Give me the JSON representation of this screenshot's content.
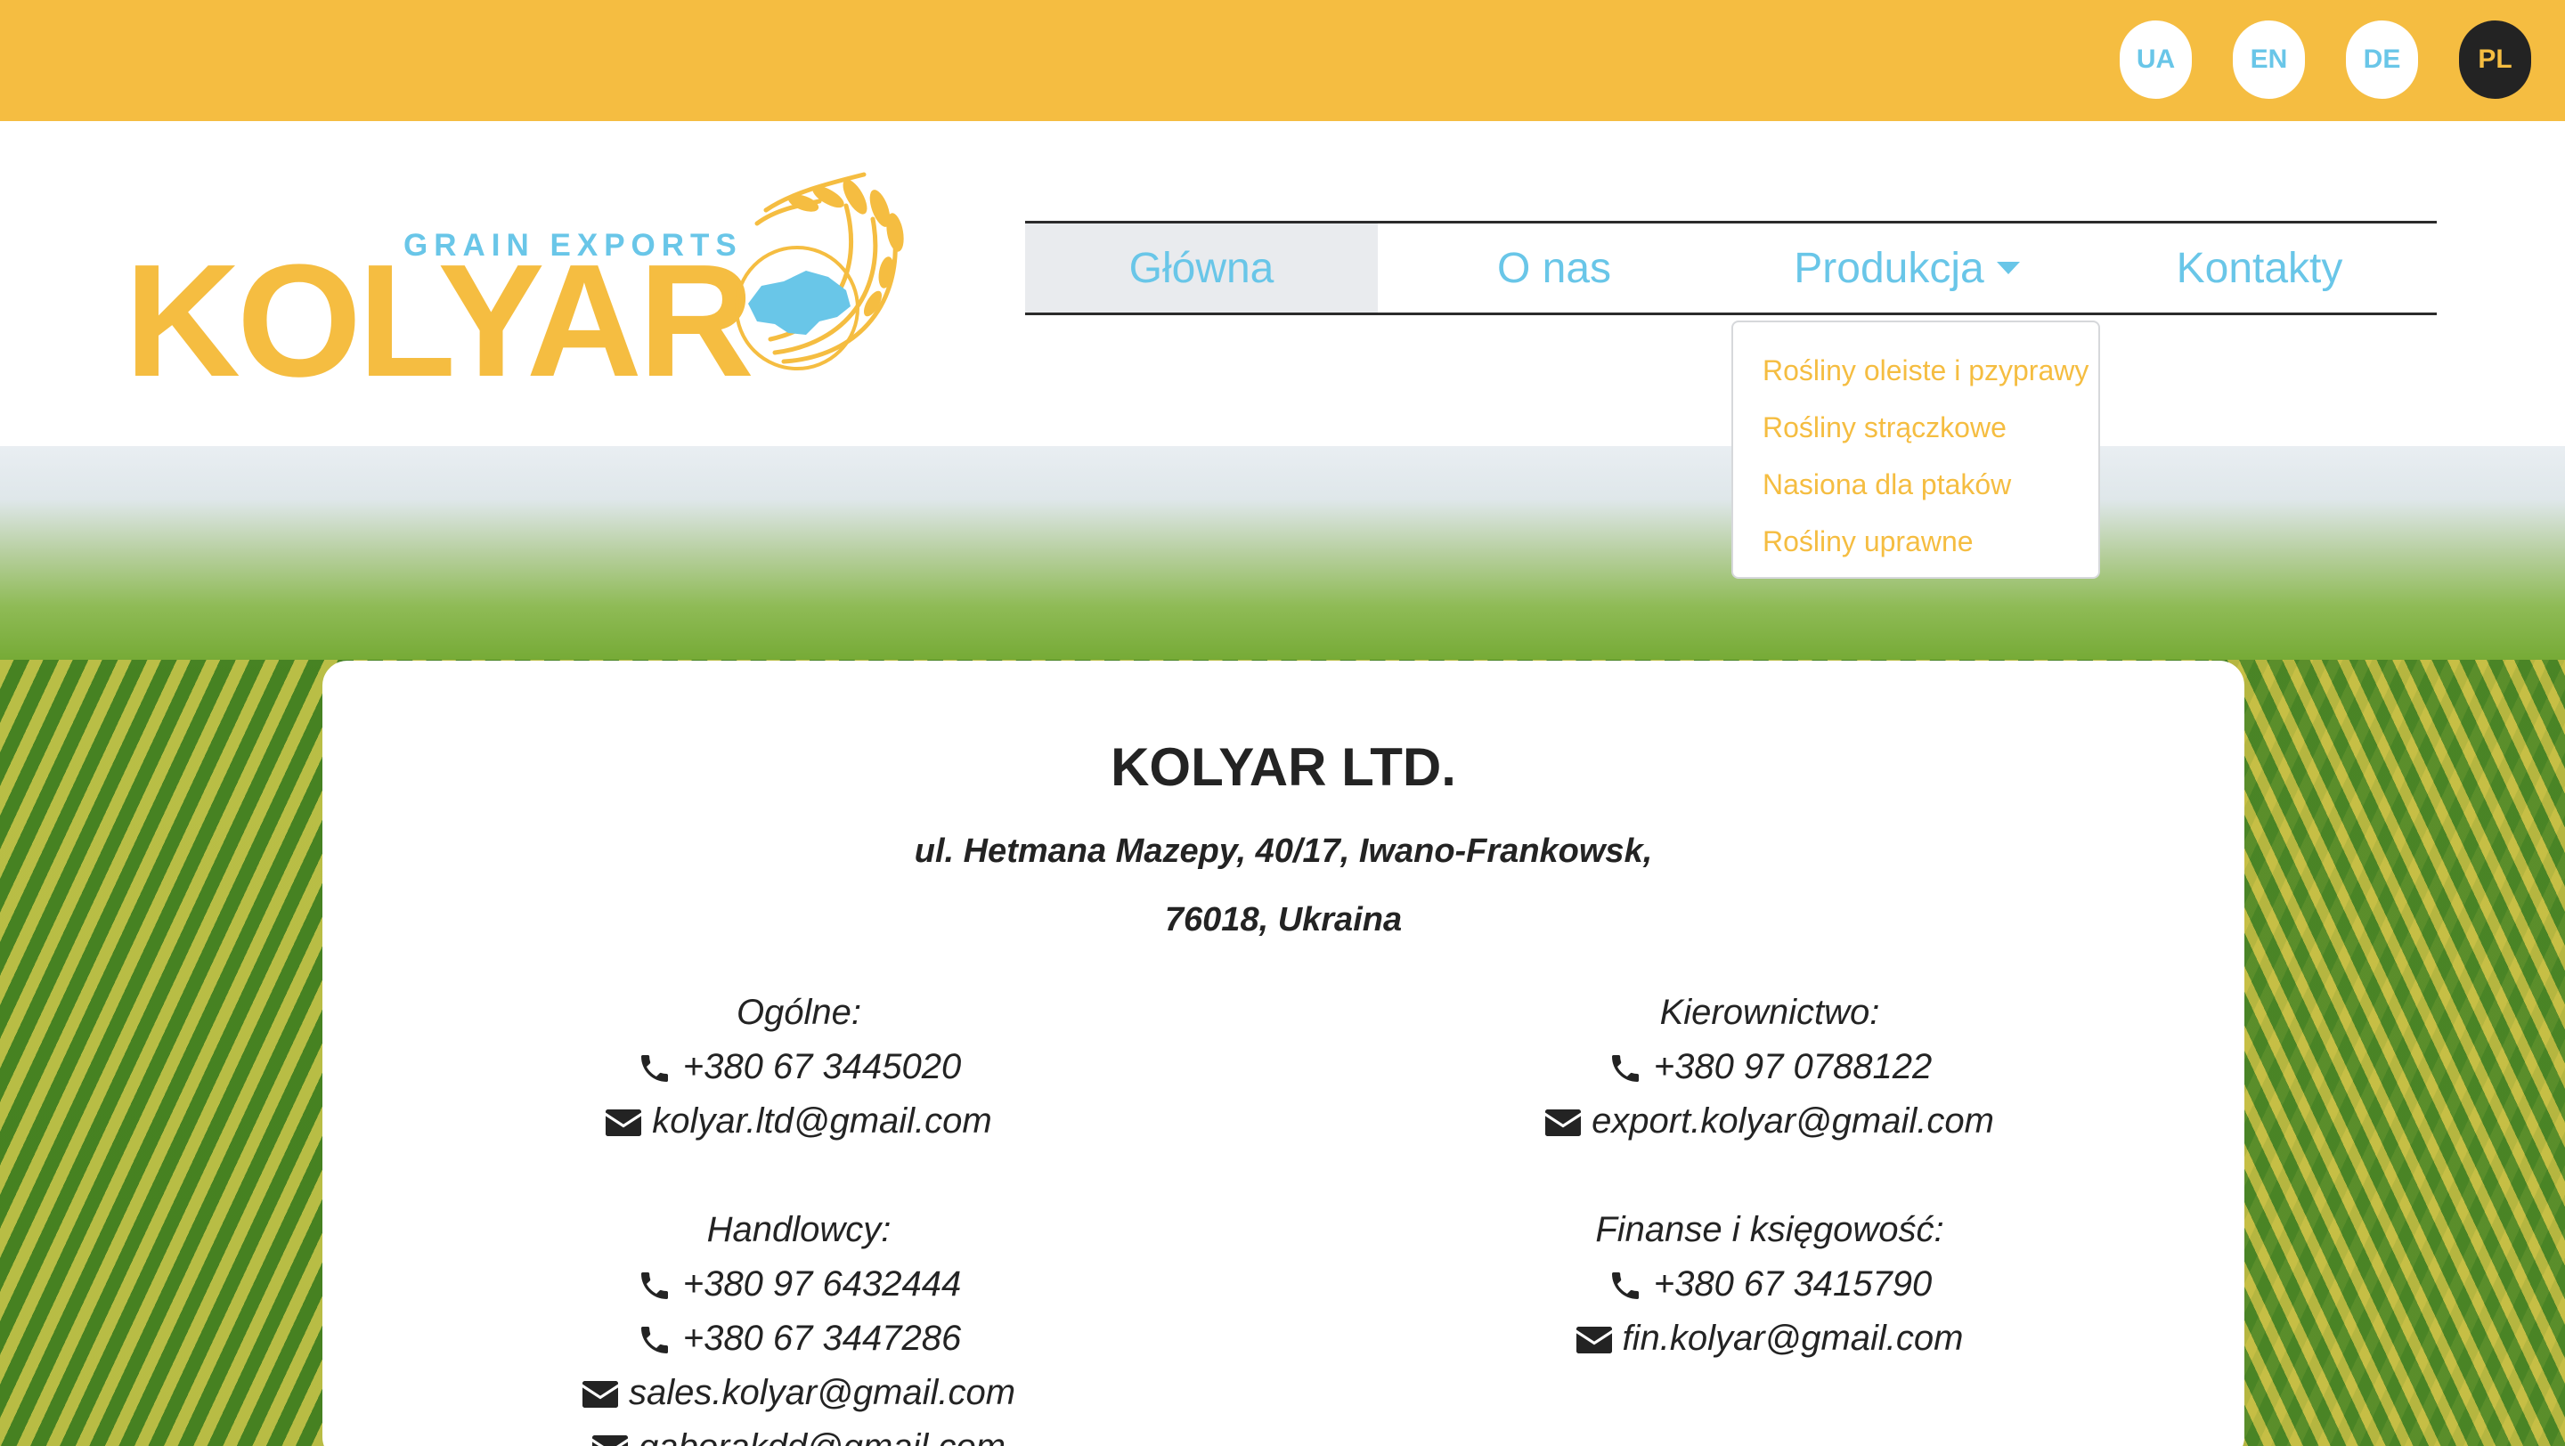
{
  "languages": [
    {
      "code": "UA",
      "active": false
    },
    {
      "code": "EN",
      "active": false
    },
    {
      "code": "DE",
      "active": false
    },
    {
      "code": "PL",
      "active": true
    }
  ],
  "logo": {
    "tagline": "GRAIN EXPORTS",
    "name": "KOLYAR"
  },
  "nav": {
    "items": [
      "Główna",
      "O nas",
      "Produkcja",
      "Kontakty"
    ],
    "active": "Główna",
    "dropdown": [
      "Rośliny oleiste i pzyprawy",
      "Rośliny strączkowe",
      "Nasiona dla ptaków",
      "Rośliny uprawne"
    ]
  },
  "contact": {
    "company": "KOLYAR LTD.",
    "address_line1": "ul. Hetmana Mazepy, 40/17, Iwano-Frankowsk,",
    "address_line2": "76018, Ukraina",
    "left": {
      "general_title": "Ogólne:",
      "general_phone": "+380 67 3445020",
      "general_email": "kolyar.ltd@gmail.com",
      "sales_title": "Handlowcy:",
      "sales_phone1": "+380 97 6432444",
      "sales_phone2": "+380 67 3447286",
      "sales_email1": "sales.kolyar@gmail.com",
      "sales_email2": "gaborakdd@gmail.com"
    },
    "right": {
      "management_title": "Kierownictwo:",
      "management_phone": "+380 97 0788122",
      "management_email": "export.kolyar@gmail.com",
      "finance_title": "Finanse i księgowość:",
      "finance_phone": "+380 67 3415790",
      "finance_email": "fin.kolyar@gmail.com"
    }
  },
  "icons": {
    "phone": "phone-icon",
    "email": "envelope-icon"
  },
  "colors": {
    "brand_yellow": "#f5bd41",
    "brand_blue": "#69c6e8",
    "dark": "#232323"
  }
}
